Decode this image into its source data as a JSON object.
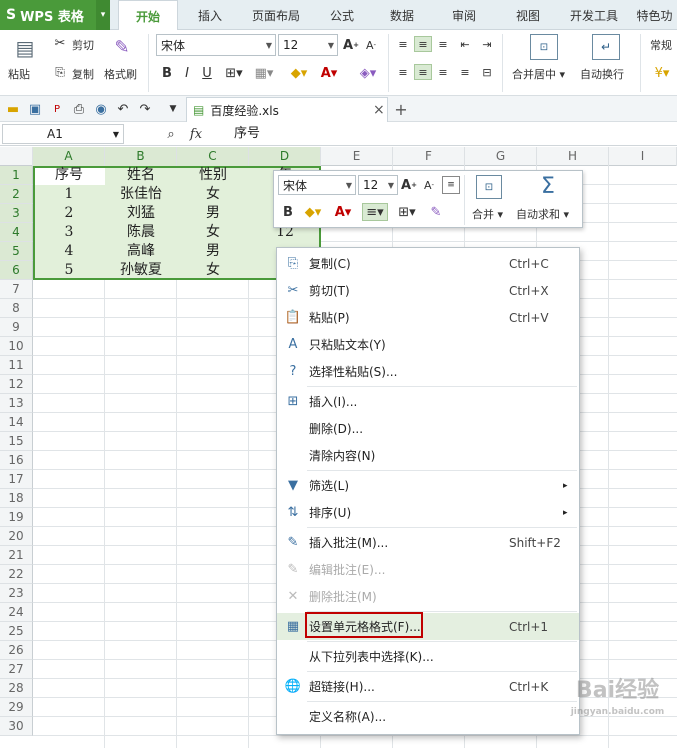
{
  "app": {
    "logo": "WPS 表格",
    "logo_drop": "▾"
  },
  "tabs": [
    "开始",
    "插入",
    "页面布局",
    "公式",
    "数据",
    "审阅",
    "视图",
    "开发工具",
    "特色功"
  ],
  "ribbon": {
    "paste": "粘贴",
    "cut": "剪切",
    "copy": "复制",
    "format_painter": "格式刷",
    "font_name": "宋体",
    "font_size": "12",
    "bold": "B",
    "italic": "I",
    "underline": "U",
    "merge_center": "合并居中",
    "wrap": "自动换行",
    "number_format": "常规"
  },
  "file_tab": {
    "name": "百度经验.xls",
    "close": "×",
    "new": "+"
  },
  "formula_bar": {
    "cell_ref": "A1",
    "fx": "fx",
    "content": "序号"
  },
  "columns": [
    "A",
    "B",
    "C",
    "D",
    "E",
    "F",
    "G",
    "H",
    "I"
  ],
  "rows": [
    "1",
    "2",
    "3",
    "4",
    "5",
    "6",
    "7",
    "8",
    "9",
    "10",
    "11",
    "12",
    "13",
    "14",
    "15",
    "16",
    "17",
    "18",
    "19",
    "20",
    "21",
    "22",
    "23",
    "24",
    "25",
    "26",
    "27",
    "28",
    "29",
    "30"
  ],
  "table": [
    [
      "序号",
      "姓名",
      "性别",
      "年"
    ],
    [
      "1",
      "张佳怡",
      "女",
      ""
    ],
    [
      "2",
      "刘猛",
      "男",
      ""
    ],
    [
      "3",
      "陈晨",
      "女",
      "12"
    ],
    [
      "4",
      "高峰",
      "男",
      ""
    ],
    [
      "5",
      "孙敏夏",
      "女",
      ""
    ]
  ],
  "mini_toolbar": {
    "font_name": "宋体",
    "font_size": "12",
    "bold": "B",
    "merge": "合并",
    "autosum": "自动求和"
  },
  "context_menu": [
    {
      "label": "复制(C)",
      "key": "Ctrl+C",
      "icon": "copy-icon",
      "glyph": "⎘"
    },
    {
      "label": "剪切(T)",
      "key": "Ctrl+X",
      "icon": "scissors-icon",
      "glyph": "✂"
    },
    {
      "label": "粘贴(P)",
      "key": "Ctrl+V",
      "icon": "paste-icon",
      "glyph": "📋"
    },
    {
      "label": "只粘贴文本(Y)",
      "key": "",
      "icon": "paste-text-icon",
      "glyph": "A"
    },
    {
      "label": "选择性粘贴(S)...",
      "key": "",
      "icon": "paste-special-icon",
      "glyph": "?"
    },
    {
      "label": "插入(I)...",
      "key": "",
      "icon": "insert-icon",
      "glyph": "⊞"
    },
    {
      "label": "删除(D)...",
      "key": "",
      "icon": "",
      "glyph": ""
    },
    {
      "label": "清除内容(N)",
      "key": "",
      "icon": "",
      "glyph": ""
    },
    {
      "label": "筛选(L)",
      "key": "",
      "icon": "filter-icon",
      "glyph": "▼"
    },
    {
      "label": "排序(U)",
      "key": "",
      "icon": "sort-icon",
      "glyph": "⇅"
    },
    {
      "label": "插入批注(M)...",
      "key": "Shift+F2",
      "icon": "comment-add-icon",
      "glyph": "✎"
    },
    {
      "label": "编辑批注(E)...",
      "key": "",
      "icon": "comment-edit-icon",
      "glyph": "✎"
    },
    {
      "label": "删除批注(M)",
      "key": "",
      "icon": "comment-delete-icon",
      "glyph": "✕"
    },
    {
      "label": "设置单元格格式(F)...",
      "key": "Ctrl+1",
      "icon": "format-cells-icon",
      "glyph": "▦"
    },
    {
      "label": "从下拉列表中选择(K)...",
      "key": "",
      "icon": "",
      "glyph": ""
    },
    {
      "label": "超链接(H)...",
      "key": "Ctrl+K",
      "icon": "hyperlink-icon",
      "glyph": "🌐"
    },
    {
      "label": "定义名称(A)...",
      "key": "",
      "icon": "",
      "glyph": ""
    }
  ],
  "colors": {
    "accent": "#4a9a3a",
    "selection": "#e2f0da",
    "highlight_border": "#c00000"
  }
}
